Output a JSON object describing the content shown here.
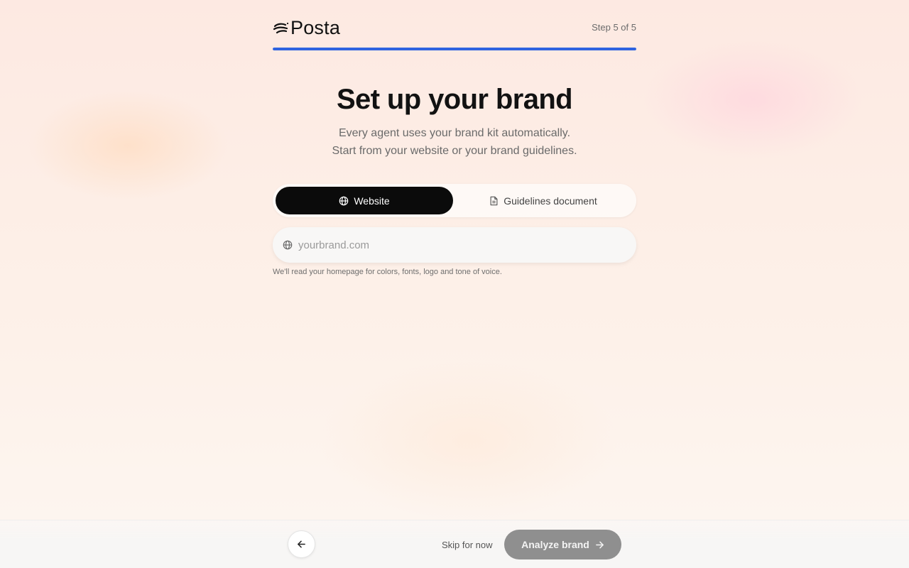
{
  "brand": {
    "name": "Posta",
    "icon": "posta-logo-swirl-icon"
  },
  "progress": {
    "step_text": "Step 5 of 5",
    "current": 5,
    "total": 5,
    "fill_fraction": 1.0,
    "color": "#2f63e0"
  },
  "heading": {
    "title": "Set up your brand",
    "subtitle_line1": "Every agent uses your brand kit automatically.",
    "subtitle_line2": "Start from your website or your brand guidelines."
  },
  "source_toggle": {
    "options": [
      {
        "label": "Website",
        "icon": "globe-icon",
        "selected": true
      },
      {
        "label": "Guidelines document",
        "icon": "document-icon",
        "selected": false
      }
    ]
  },
  "website_input": {
    "placeholder": "yourbrand.com",
    "value": "",
    "icon": "globe-icon",
    "hint": "We'll read your homepage for colors, fonts, logo and tone of voice."
  },
  "footer": {
    "back_icon": "arrow-left-icon",
    "skip_label": "Skip for now",
    "primary_label": "Analyze brand",
    "primary_icon": "arrow-right-icon",
    "primary_enabled": false
  },
  "colors": {
    "selected_tab": "#0b0b0b",
    "primary_disabled": "#8f8f8f"
  }
}
